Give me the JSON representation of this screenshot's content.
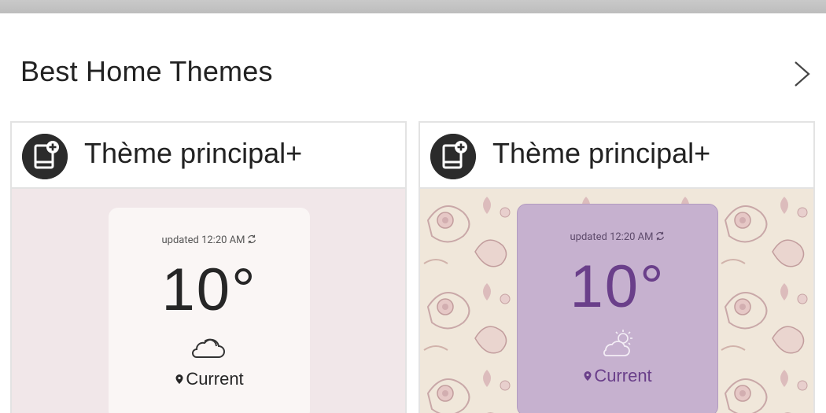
{
  "section": {
    "title": "Best Home Themes"
  },
  "themes": [
    {
      "title": "Thème principal+",
      "widget": {
        "updated": "updated 12:20 AM",
        "temperature": "10°",
        "location": "Current"
      },
      "weather_icon": "cloud-icon",
      "colors": {
        "background": "#f1e7e9",
        "widget": "#faf6f5",
        "text": "#262626"
      }
    },
    {
      "title": "Thème principal+",
      "widget": {
        "updated": "updated 12:20 AM",
        "temperature": "10°",
        "location": "Current"
      },
      "weather_icon": "partly-sunny-icon",
      "colors": {
        "background": "#f0e8dc",
        "widget": "#c6b1cf",
        "text": "#6a3f8a"
      }
    }
  ]
}
